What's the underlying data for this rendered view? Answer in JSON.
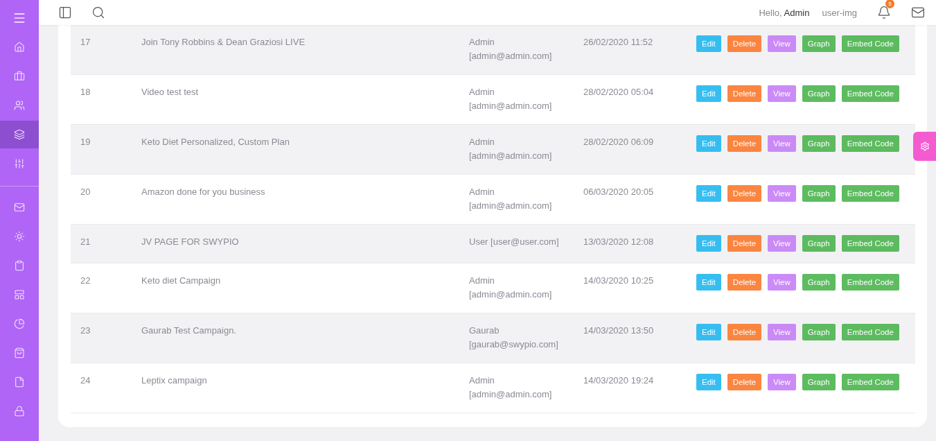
{
  "sidebar": {
    "items": [
      {
        "selected": false
      },
      {
        "selected": false
      },
      {
        "selected": false
      },
      {
        "selected": true
      },
      {
        "selected": false
      },
      {
        "selected": false
      },
      {
        "selected": false
      },
      {
        "selected": false
      },
      {
        "selected": false
      },
      {
        "selected": false
      },
      {
        "selected": false
      },
      {
        "selected": false
      },
      {
        "selected": false
      }
    ]
  },
  "header": {
    "greeting": "Hello, **Admin**",
    "user_image_alt": "user-img",
    "notification_count": "5"
  },
  "table": {
    "rows": [
      {
        "id": "17",
        "title": "Join Tony Robbins & Dean Graziosi LIVE",
        "user": "Admin [admin@admin.com]",
        "date": "26/02/2020 11:52",
        "actions": [
          "Edit",
          "Delete",
          "View",
          "Graph",
          "Embed Code"
        ]
      },
      {
        "id": "18",
        "title": "Video test test",
        "user": "Admin [admin@admin.com]",
        "date": "28/02/2020 05:04",
        "actions": [
          "Edit",
          "Delete",
          "View",
          "Graph",
          "Embed Code"
        ]
      },
      {
        "id": "19",
        "title": "Keto Diet Personalized, Custom Plan",
        "user": "Admin [admin@admin.com]",
        "date": "28/02/2020 06:09",
        "actions": [
          "Edit",
          "Delete",
          "View",
          "Graph",
          "Embed Code"
        ]
      },
      {
        "id": "20",
        "title": "Amazon done for you business",
        "user": "Admin [admin@admin.com]",
        "date": "06/03/2020 20:05",
        "actions": [
          "Edit",
          "Delete",
          "View",
          "Graph",
          "Embed Code"
        ]
      },
      {
        "id": "21",
        "title": "JV PAGE FOR SWYPIO",
        "user": "User [user@user.com]",
        "date": "13/03/2020 12:08",
        "actions": [
          "Edit",
          "Delete",
          "View",
          "Graph",
          "Embed Code"
        ]
      },
      {
        "id": "22",
        "title": "Keto diet Campaign",
        "user": "Admin [admin@admin.com]",
        "date": "14/03/2020 10:25",
        "actions": [
          "Edit",
          "Delete",
          "View",
          "Graph",
          "Embed Code"
        ]
      },
      {
        "id": "23",
        "title": "Gaurab Test Campaign.",
        "user": "Gaurab [gaurab@swypio.com]",
        "date": "14/03/2020 13:50",
        "actions": [
          "Edit",
          "Delete",
          "View",
          "Graph",
          "Embed Code"
        ]
      },
      {
        "id": "24",
        "title": "Leptix campaign",
        "user": "Admin [admin@admin.com]",
        "date": "14/03/2020 19:24",
        "actions": [
          "Edit",
          "Delete",
          "View",
          "Graph",
          "Embed Code"
        ]
      }
    ]
  }
}
